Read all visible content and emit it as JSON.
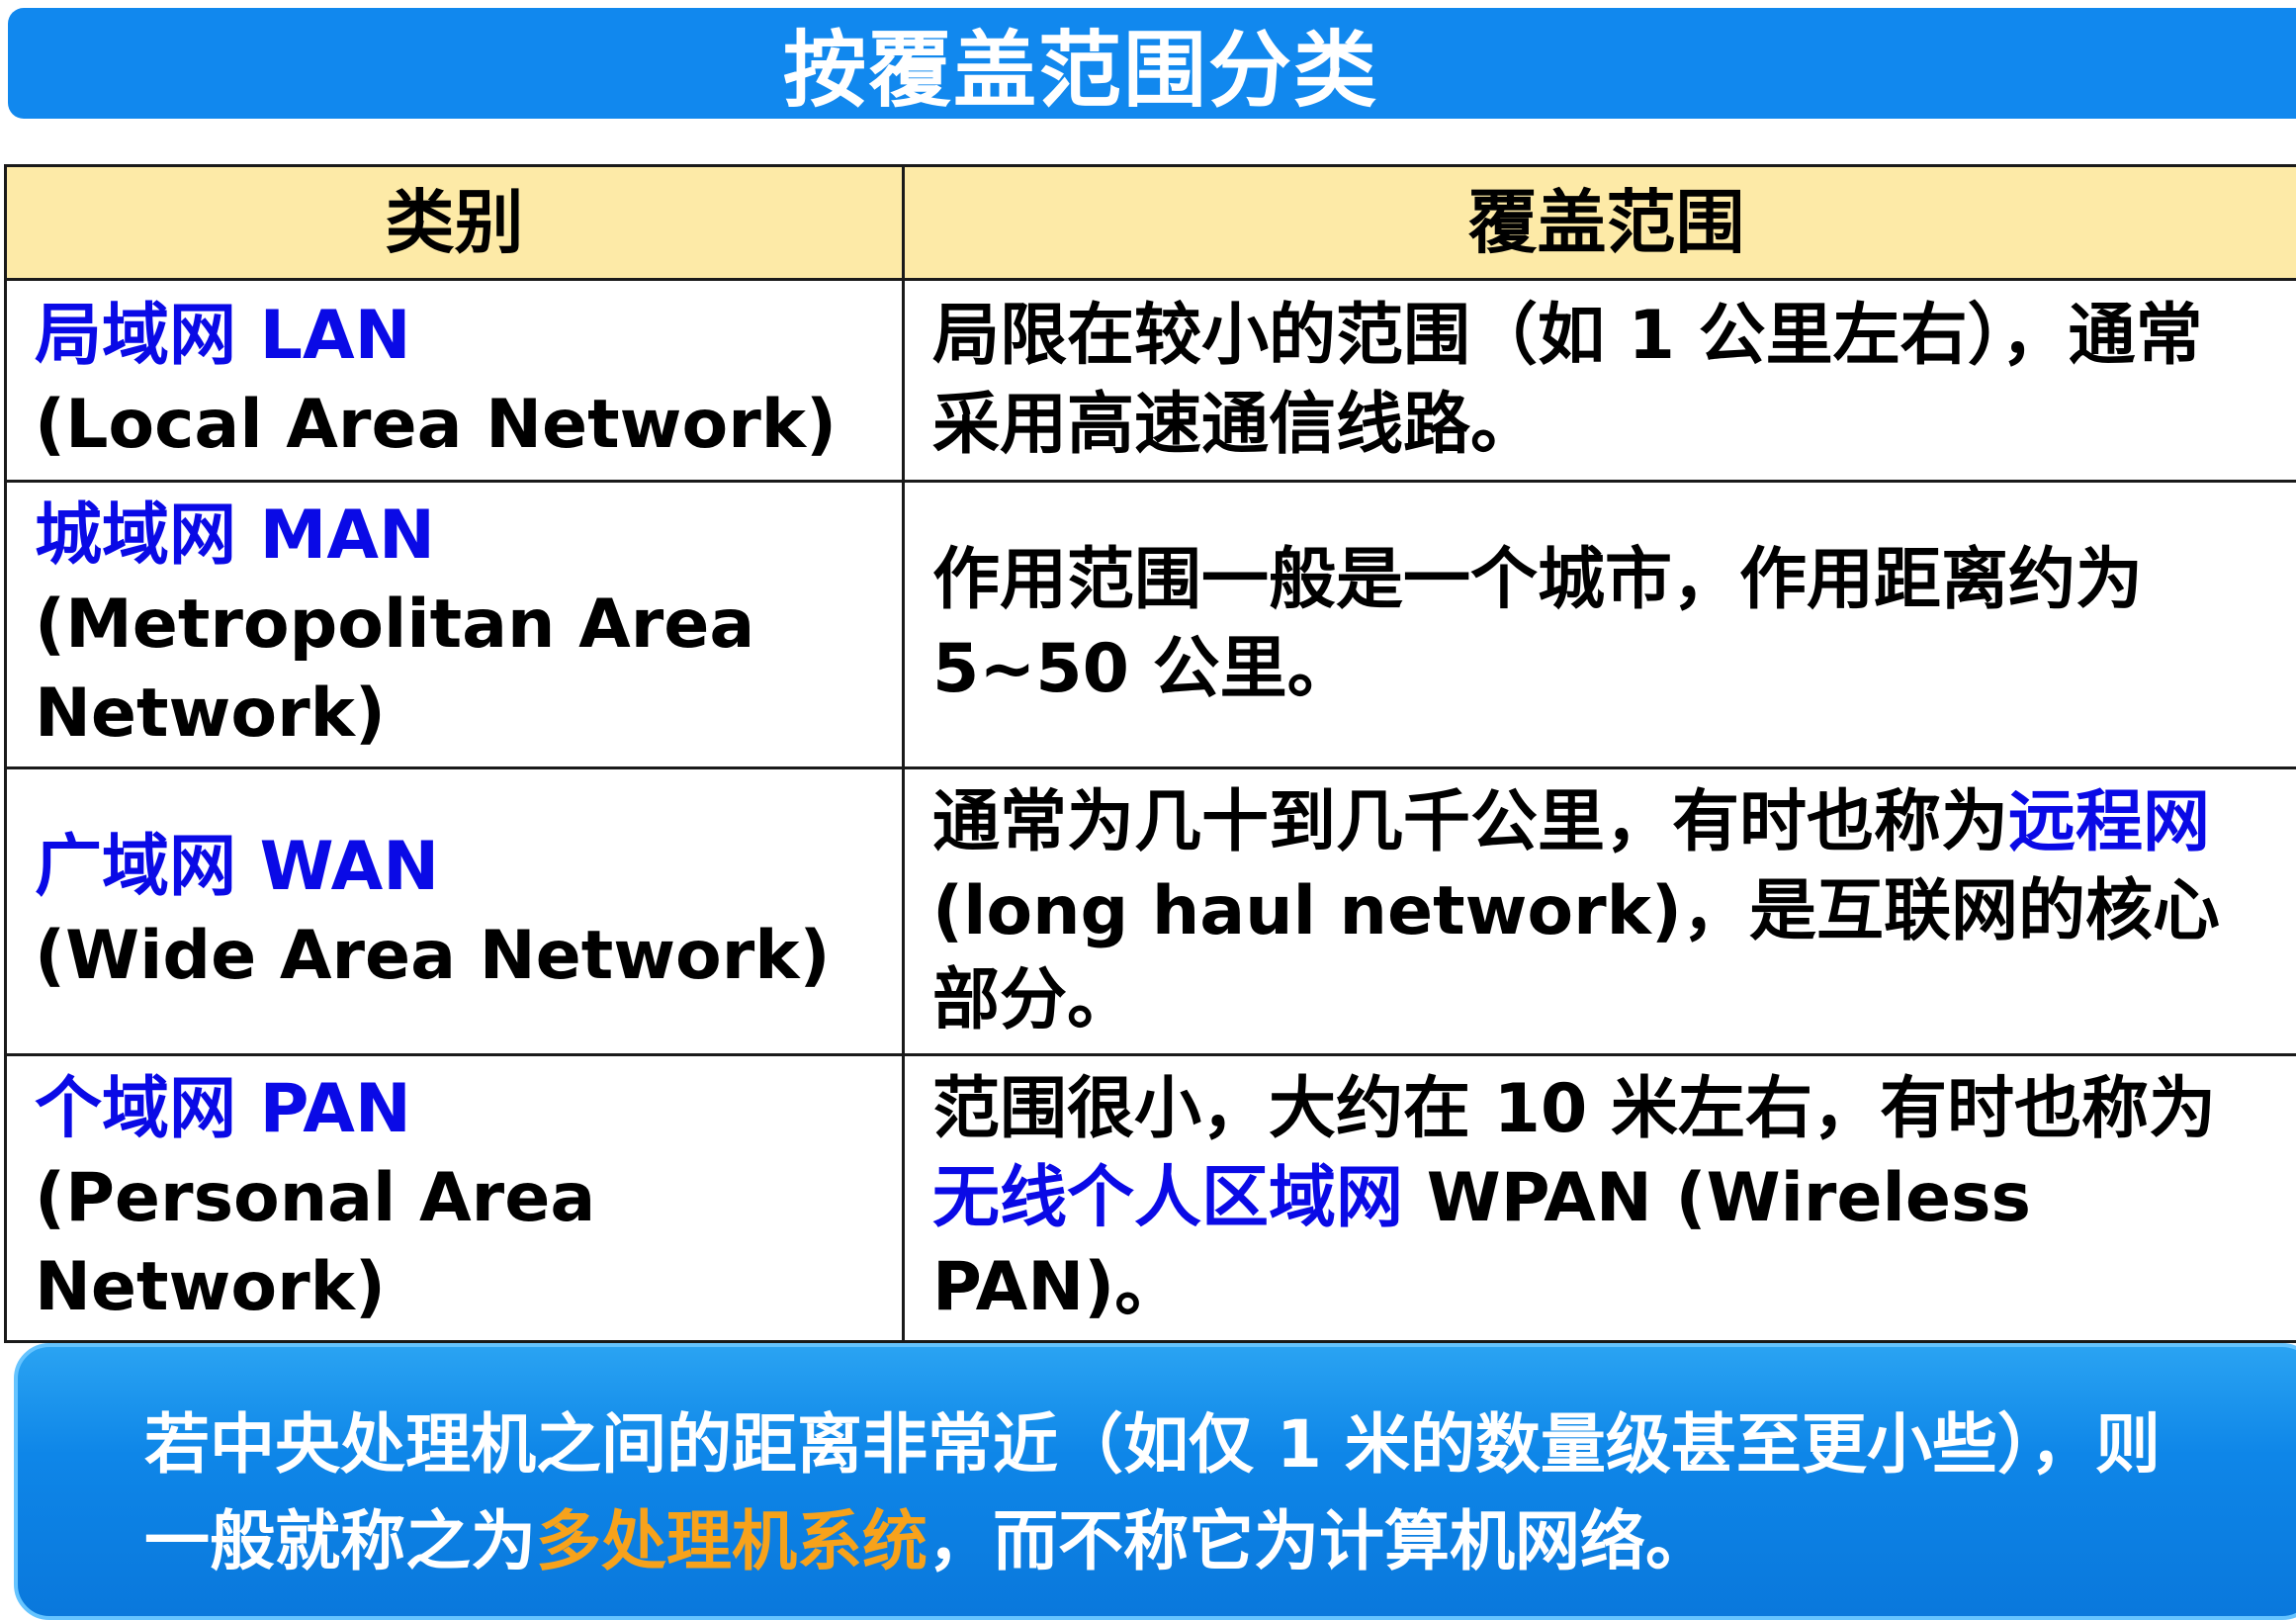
{
  "title": "按覆盖范围分类",
  "table": {
    "headers": [
      "类别",
      "覆盖范围"
    ],
    "rows": [
      {
        "type_cn": "局域网 LAN",
        "type_en": "(Local Area Network)",
        "range_parts": [
          "局限在较小的范围（如 1 公里左右），通常采用高速通信线路。"
        ]
      },
      {
        "type_cn": "城域网 MAN",
        "type_en": "(Metropolitan Area Network)",
        "range_parts": [
          "作用范围一般是一个城市，作用距离约为 5~50 公里。"
        ]
      },
      {
        "type_cn": "广域网 WAN",
        "type_en": "(Wide Area Network)",
        "range_parts": [
          "通常为几十到几千公里，有时也称为",
          "远程网",
          "(long haul network)，是互联网的核心部分。"
        ]
      },
      {
        "type_cn": "个域网 PAN",
        "type_en": "(Personal Area Network)",
        "range_parts": [
          "范围很小，大约在 10 米左右，有时也称为",
          "无线个人区域网",
          " WPAN (Wireless PAN)。"
        ]
      }
    ]
  },
  "note": {
    "part1": "若中央处理机之间的距离非常近（如仅 1 米的数量级甚至更小些），则一般就称之为",
    "highlight": "多处理机系统",
    "part2": "，而不称它为计算机网络。"
  },
  "colors": {
    "title_bg": "#1188ee",
    "header_bg": "#fdeaa7",
    "category_text": "#0a0ae6",
    "note_bg": "#0e86e8",
    "note_highlight": "#f7a21b"
  }
}
